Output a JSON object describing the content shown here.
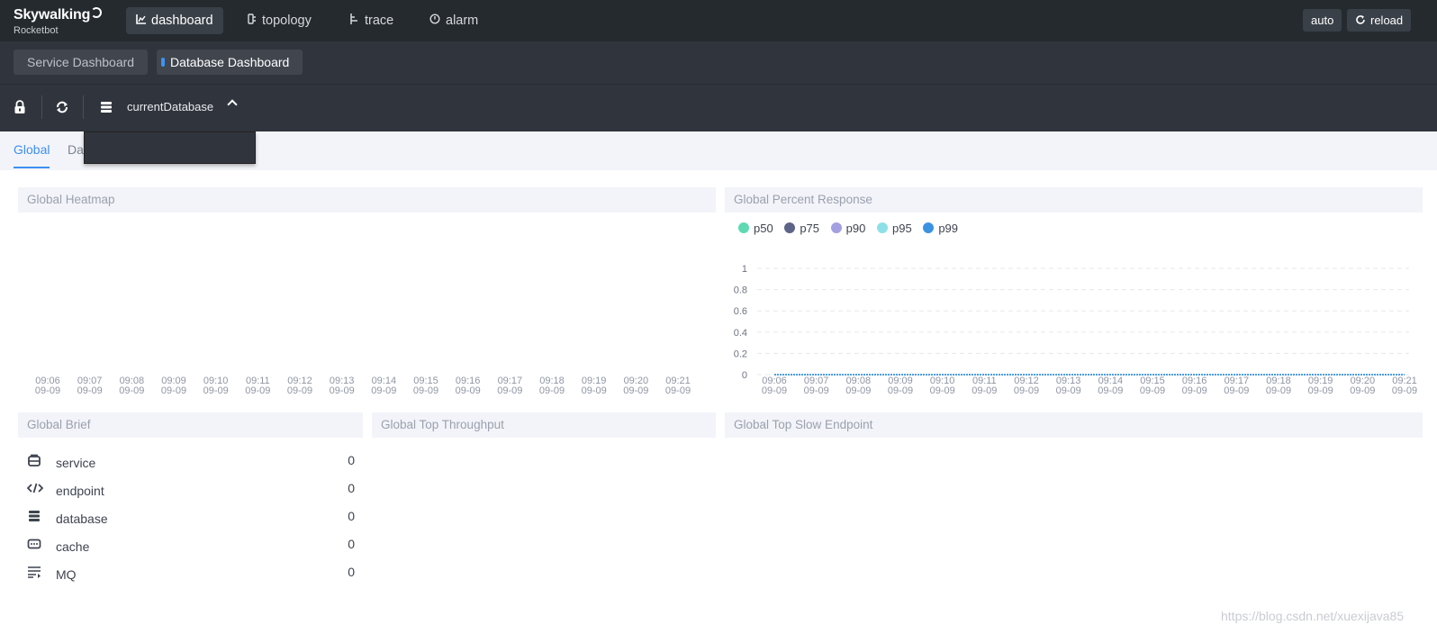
{
  "app": {
    "logo_main": "Skywalking",
    "logo_sub": "Rocketbot"
  },
  "nav": {
    "items": [
      {
        "label": "dashboard",
        "icon": "chart-icon",
        "active": true
      },
      {
        "label": "topology",
        "icon": "topology-icon",
        "active": false
      },
      {
        "label": "trace",
        "icon": "trace-icon",
        "active": false
      },
      {
        "label": "alarm",
        "icon": "alarm-icon",
        "active": false
      }
    ],
    "auto_label": "auto",
    "reload_label": "reload"
  },
  "dashboards": {
    "tabs": [
      {
        "label": "Service Dashboard",
        "active": false
      },
      {
        "label": "Database Dashboard",
        "active": true
      }
    ]
  },
  "toolbar": {
    "selector_label": "currentDatabase"
  },
  "page_tabs": {
    "global": "Global",
    "second_partial": "Da"
  },
  "panels": {
    "heatmap_title": "Global Heatmap",
    "percent_title": "Global Percent Response",
    "brief_title": "Global Brief",
    "throughput_title": "Global Top Throughput",
    "slow_title": "Global Top Slow Endpoint"
  },
  "legend": [
    {
      "name": "p50",
      "color": "#5fd9b2"
    },
    {
      "name": "p75",
      "color": "#5d6487"
    },
    {
      "name": "p90",
      "color": "#a39fe0"
    },
    {
      "name": "p95",
      "color": "#8ee0e8"
    },
    {
      "name": "p99",
      "color": "#3b92e1"
    }
  ],
  "brief": [
    {
      "label": "service",
      "value": "0",
      "icon": "service-icon"
    },
    {
      "label": "endpoint",
      "value": "0",
      "icon": "endpoint-icon"
    },
    {
      "label": "database",
      "value": "0",
      "icon": "database-icon"
    },
    {
      "label": "cache",
      "value": "0",
      "icon": "cache-icon"
    },
    {
      "label": "MQ",
      "value": "0",
      "icon": "mq-icon"
    }
  ],
  "chart_data": [
    {
      "type": "heatmap",
      "title": "Global Heatmap",
      "x": [
        "09:06\n09-09",
        "09:07\n09-09",
        "09:08\n09-09",
        "09:09\n09-09",
        "09:10\n09-09",
        "09:11\n09-09",
        "09:12\n09-09",
        "09:13\n09-09",
        "09:14\n09-09",
        "09:15\n09-09",
        "09:16\n09-09",
        "09:17\n09-09",
        "09:18\n09-09",
        "09:19\n09-09",
        "09:20\n09-09",
        "09:21\n09-09"
      ],
      "values": []
    },
    {
      "type": "line",
      "title": "Global Percent Response",
      "x": [
        "09:06\n09-09",
        "09:07\n09-09",
        "09:08\n09-09",
        "09:09\n09-09",
        "09:10\n09-09",
        "09:11\n09-09",
        "09:12\n09-09",
        "09:13\n09-09",
        "09:14\n09-09",
        "09:15\n09-09",
        "09:16\n09-09",
        "09:17\n09-09",
        "09:18\n09-09",
        "09:19\n09-09",
        "09:20\n09-09",
        "09:21\n09-09"
      ],
      "yticks": [
        "0",
        "0.2",
        "0.4",
        "0.6",
        "0.8",
        "1"
      ],
      "ylim": [
        0,
        1
      ],
      "grid": true,
      "series": [
        {
          "name": "p50",
          "values": [
            0,
            0,
            0,
            0,
            0,
            0,
            0,
            0,
            0,
            0,
            0,
            0,
            0,
            0,
            0,
            0
          ]
        },
        {
          "name": "p75",
          "values": [
            0,
            0,
            0,
            0,
            0,
            0,
            0,
            0,
            0,
            0,
            0,
            0,
            0,
            0,
            0,
            0
          ]
        },
        {
          "name": "p90",
          "values": [
            0,
            0,
            0,
            0,
            0,
            0,
            0,
            0,
            0,
            0,
            0,
            0,
            0,
            0,
            0,
            0
          ]
        },
        {
          "name": "p95",
          "values": [
            0,
            0,
            0,
            0,
            0,
            0,
            0,
            0,
            0,
            0,
            0,
            0,
            0,
            0,
            0,
            0
          ]
        },
        {
          "name": "p99",
          "values": [
            0,
            0,
            0,
            0,
            0,
            0,
            0,
            0,
            0,
            0,
            0,
            0,
            0,
            0,
            0,
            0
          ]
        }
      ]
    }
  ],
  "watermark": "https://blog.csdn.net/xuexijava85"
}
